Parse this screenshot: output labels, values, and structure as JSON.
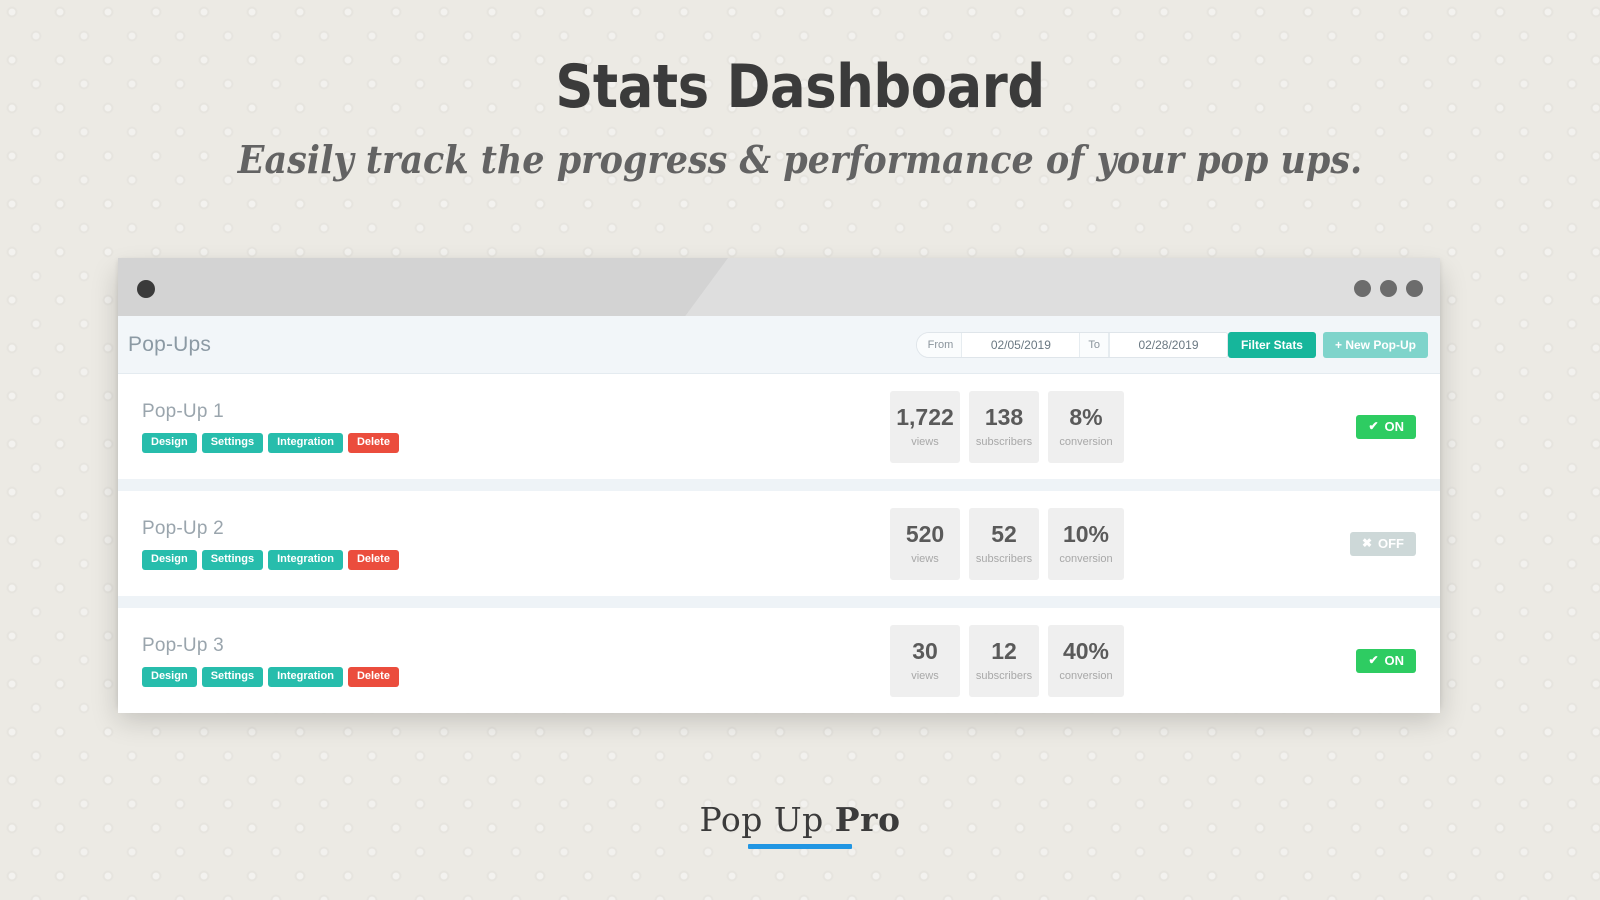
{
  "header": {
    "title": "Stats Dashboard",
    "subtitle": "Easily track the progress & performance of your pop ups."
  },
  "window": {
    "titlebar": {
      "left_dot": "window-dot",
      "right_dots": [
        "dot",
        "dot",
        "dot"
      ]
    }
  },
  "toolbar": {
    "title": "Pop-Ups",
    "from_label": "From",
    "from_value": "02/05/2019",
    "from_placeholder": "MM/DD/YYYY",
    "to_label": "To",
    "to_value": "02/28/2019",
    "to_placeholder": "MM/DD/YYYY",
    "filter_label": "Filter Stats",
    "new_popup_label": "+ New Pop-Up"
  },
  "action_labels": {
    "design": "Design",
    "settings": "Settings",
    "integration": "Integration",
    "delete": "Delete"
  },
  "stat_labels": {
    "views": "views",
    "subscribers": "subscribers",
    "conversion": "conversion"
  },
  "toggle_labels": {
    "on": "ON",
    "off": "OFF",
    "on_glyph": "✔",
    "off_glyph": "✖"
  },
  "rows": [
    {
      "name": "Pop-Up 1",
      "views": "1,722",
      "subscribers": "138",
      "conversion": "8%",
      "status": "ON"
    },
    {
      "name": "Pop-Up 2",
      "views": "520",
      "subscribers": "52",
      "conversion": "10%",
      "status": "OFF"
    },
    {
      "name": "Pop-Up 3",
      "views": "30",
      "subscribers": "12",
      "conversion": "40%",
      "status": "ON"
    }
  ],
  "footer": {
    "logo_light": "Pop Up ",
    "logo_bold": "Pro"
  },
  "colors": {
    "teal": "#27bdac",
    "teal_dark": "#16b69b",
    "teal_light": "#7fd4cb",
    "red": "#eb4d3d",
    "green": "#2ecc62",
    "off_gray": "#cdd8d8",
    "accent_blue": "#2196e3"
  }
}
